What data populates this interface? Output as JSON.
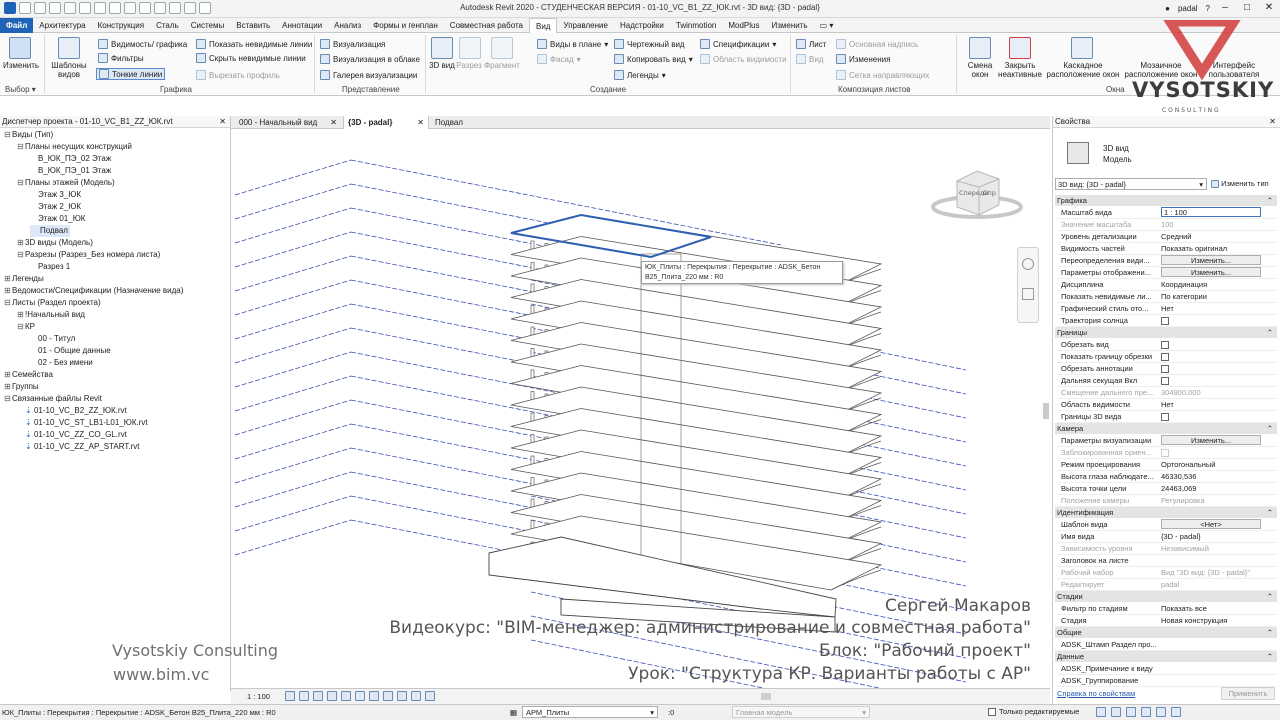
{
  "app_title": "Autodesk Revit 2020 - СТУДЕНЧЕСКАЯ ВЕРСИЯ - 01-10_VC_B1_ZZ_ЮК.rvt - 3D вид: {3D - padal}",
  "user": "padal",
  "tabs": [
    "Файл",
    "Архитектура",
    "Конструкция",
    "Сталь",
    "Системы",
    "Вставить",
    "Аннотации",
    "Анализ",
    "Формы и генплан",
    "Совместная работа",
    "Вид",
    "Управление",
    "Надстройки",
    "Twinmotion",
    "ModPlus",
    "Изменить"
  ],
  "active_tab": "Вид",
  "ribbon": {
    "modify": "Изменить",
    "view_templates": "Шаблоны видов",
    "visibility_graphics": "Видимость/ графика",
    "filters": "Фильтры",
    "thin_lines": "Тонкие линии",
    "show_hidden_lines": "Показать невидимые линии",
    "remove_hidden_lines": "Скрыть невидимые линии",
    "cut_profile": "Вырезать профиль",
    "render": "Визуализация",
    "render_cloud": "Визуализация в облаке",
    "render_gallery": "Галерея визуализации",
    "view_3d": "3D вид",
    "section": "Разрез",
    "callout": "Фрагмент",
    "plan_views": "Виды в плане",
    "elevation": "Фасад",
    "drafting_view": "Чертежный вид",
    "duplicate_view": "Копировать вид",
    "legends": "Легенды",
    "schedules": "Спецификации",
    "scope_box": "Область видимости",
    "sheet": "Лист",
    "view": "Вид",
    "title_block": "Основная надпись",
    "revisions": "Изменения",
    "guide_grid": "Сетка направляющих",
    "matchline": "Линия",
    "switch_windows": "Смена окон",
    "close_inactive": "Закрыть неактивные",
    "cascade": "Каскадное расположение окон",
    "tile": "Мозаичное расположение окон",
    "user_interface": "Интерфейс пользователя",
    "panels": {
      "select": "Выбор",
      "graphics": "Графика",
      "presentation": "Представление",
      "create": "Создание",
      "sheet_composition": "Композиция листов",
      "windows": "Окна"
    }
  },
  "project_browser": {
    "title": "Диспетчер проекта - 01-10_VC_B1_ZZ_ЮК.rvt",
    "items": [
      {
        "label": "Виды (Тип)",
        "level": 0,
        "toggle": "−"
      },
      {
        "label": "Планы несущих конструкций",
        "level": 1,
        "toggle": "−"
      },
      {
        "label": "В_ЮК_ПЭ_02 Этаж",
        "level": 2,
        "toggle": ""
      },
      {
        "label": "В_ЮК_ПЭ_01 Этаж",
        "level": 2,
        "toggle": ""
      },
      {
        "label": "Планы этажей (Модель)",
        "level": 1,
        "toggle": "−"
      },
      {
        "label": "Этаж 3_ЮК",
        "level": 2,
        "toggle": ""
      },
      {
        "label": "Этаж 2_ЮК",
        "level": 2,
        "toggle": ""
      },
      {
        "label": "Этаж 01_ЮК",
        "level": 2,
        "toggle": ""
      },
      {
        "label": "Подвал",
        "level": 2,
        "toggle": "",
        "selected": true
      },
      {
        "label": "3D виды (Модель)",
        "level": 1,
        "toggle": "+"
      },
      {
        "label": "Разрезы (Разрез_Без номера листа)",
        "level": 1,
        "toggle": "−"
      },
      {
        "label": "Разрез 1",
        "level": 2,
        "toggle": ""
      },
      {
        "label": "Легенды",
        "level": 0,
        "toggle": "+"
      },
      {
        "label": "Ведомости/Спецификации (Назначение вида)",
        "level": 0,
        "toggle": "+"
      },
      {
        "label": "Листы (Раздел проекта)",
        "level": 0,
        "toggle": "−"
      },
      {
        "label": "!Начальный вид",
        "level": 1,
        "toggle": "+"
      },
      {
        "label": "КР",
        "level": 1,
        "toggle": "−"
      },
      {
        "label": "00 - Титул",
        "level": 2,
        "toggle": ""
      },
      {
        "label": "01 - Общие данные",
        "level": 2,
        "toggle": ""
      },
      {
        "label": "02 - Без имени",
        "level": 2,
        "toggle": ""
      },
      {
        "label": "Семейства",
        "level": 0,
        "toggle": "+"
      },
      {
        "label": "Группы",
        "level": 0,
        "toggle": "+"
      },
      {
        "label": "Связанные файлы Revit",
        "level": 0,
        "toggle": "−"
      },
      {
        "label": "01-10_VC_B2_ZZ_ЮК.rvt",
        "level": 1,
        "toggle": "",
        "link": true
      },
      {
        "label": "01-10_VC_ST_LB1-L01_ЮК.rvt",
        "level": 1,
        "toggle": "",
        "link": true
      },
      {
        "label": "01-10_VC_ZZ_CO_GL.rvt",
        "level": 1,
        "toggle": "",
        "link": true
      },
      {
        "label": "01-10_VC_ZZ_AP_START.rvt",
        "level": 1,
        "toggle": "",
        "link": true
      }
    ]
  },
  "view_tabs": [
    {
      "label": "000 - Начальный вид",
      "active": false
    },
    {
      "label": "{3D - padal}",
      "active": true
    },
    {
      "label": "Подвал",
      "active": false
    }
  ],
  "tooltip": {
    "line1": "ЮК_Плиты : Перекрытия : Перекрытие : ADSK_Бетон",
    "line2": "В25_Плита_220 мм : R0"
  },
  "viewcube": {
    "front": "Спереди",
    "right": "Спр"
  },
  "watermark": {
    "author": "Сергей Макаров",
    "course": "Видеокурс: \"BIM-менеджер: администрирование и совместная работа\"",
    "block": "Блок: \"Рабочий проект\"",
    "lesson": "Урок: \"Структура КР. Варианты работы с АР\"",
    "company": "Vysotskiy Consulting",
    "site": "www.bim.vc",
    "logo_text": "VYSOTSKIY",
    "logo_sub": "C O N S U L T I N G"
  },
  "properties": {
    "title": "Свойства",
    "type_name": "3D вид",
    "type_sub": "Модель",
    "selector": "3D вид: {3D - padal}",
    "edit_type": "Изменить тип",
    "sections": [
      {
        "name": "Графика",
        "rows": [
          {
            "k": "Масштаб вида",
            "v": "1 : 100",
            "kind": "input"
          },
          {
            "k": "Значение масштаба",
            "v": "100",
            "kind": "dis"
          },
          {
            "k": "Уровень детализации",
            "v": "Средний",
            "kind": "text"
          },
          {
            "k": "Видимость частей",
            "v": "Показать оригинал",
            "kind": "text"
          },
          {
            "k": "Переопределения види...",
            "v": "Изменить...",
            "kind": "button"
          },
          {
            "k": "Параметры отображени...",
            "v": "Изменить...",
            "kind": "button"
          },
          {
            "k": "Дисциплина",
            "v": "Координация",
            "kind": "text"
          },
          {
            "k": "Показать невидимые ли...",
            "v": "По категории",
            "kind": "text"
          },
          {
            "k": "Графический стиль ото...",
            "v": "Нет",
            "kind": "text"
          },
          {
            "k": "Траектория солнца",
            "v": "",
            "kind": "check"
          }
        ]
      },
      {
        "name": "Границы",
        "rows": [
          {
            "k": "Обрезать вид",
            "v": "",
            "kind": "check"
          },
          {
            "k": "Показать границу обрезки",
            "v": "",
            "kind": "check"
          },
          {
            "k": "Обрезать аннотации",
            "v": "",
            "kind": "check"
          },
          {
            "k": "Дальняя секущая Вкл",
            "v": "",
            "kind": "check"
          },
          {
            "k": "Смещение дальнего пре...",
            "v": "304800,000",
            "kind": "dis"
          },
          {
            "k": "Область видимости",
            "v": "Нет",
            "kind": "text"
          },
          {
            "k": "Границы 3D вида",
            "v": "",
            "kind": "check"
          }
        ]
      },
      {
        "name": "Камера",
        "rows": [
          {
            "k": "Параметры визуализации",
            "v": "Изменить...",
            "kind": "button"
          },
          {
            "k": "Заблокированная ориен...",
            "v": "",
            "kind": "dischk"
          },
          {
            "k": "Режим проецирования",
            "v": "Ортогональный",
            "kind": "text"
          },
          {
            "k": "Высота глаза наблюдате...",
            "v": "46330,536",
            "kind": "text"
          },
          {
            "k": "Высота точки цели",
            "v": "24463,069",
            "kind": "text"
          },
          {
            "k": "Положение камеры",
            "v": "Регулировка",
            "kind": "dis"
          }
        ]
      },
      {
        "name": "Идентификация",
        "rows": [
          {
            "k": "Шаблон вида",
            "v": "<Нет>",
            "kind": "button"
          },
          {
            "k": "Имя вида",
            "v": "{3D - padal}",
            "kind": "text"
          },
          {
            "k": "Зависимость уровня",
            "v": "Независимый",
            "kind": "dis"
          },
          {
            "k": "Заголовок на листе",
            "v": "",
            "kind": "text"
          },
          {
            "k": "Рабочий набор",
            "v": "Вид \"3D вид: {3D - padal}\"",
            "kind": "dis"
          },
          {
            "k": "Редактирует",
            "v": "padal",
            "kind": "dis"
          }
        ]
      },
      {
        "name": "Стадии",
        "rows": [
          {
            "k": "Фильтр по стадиям",
            "v": "Показать все",
            "kind": "text"
          },
          {
            "k": "Стадия",
            "v": "Новая конструкция",
            "kind": "text"
          }
        ]
      },
      {
        "name": "Общие",
        "rows": [
          {
            "k": "ADSK_Штамп Раздел про...",
            "v": "",
            "kind": "text"
          }
        ]
      },
      {
        "name": "Данные",
        "rows": [
          {
            "k": "ADSK_Примечание к виду",
            "v": "",
            "kind": "text"
          },
          {
            "k": "ADSK_Группирование",
            "v": "",
            "kind": "text"
          }
        ]
      }
    ],
    "help_link": "Справка по свойствам",
    "apply": "Применить"
  },
  "view_control": {
    "scale": "1 : 100"
  },
  "status": {
    "text": "ЮК_Плиты : Перекрытия : Перекрытие : ADSK_Бетон В25_Плита_220 мм : R0",
    "workset": "АРМ_Плиты",
    "main_model": "Главная модель",
    "editable_only": "Только редактируемые",
    "count": ":0"
  },
  "colors": {
    "file_tab": "#1e63b5",
    "selection": "#2e5fb0",
    "logo_red": "#d03a3a"
  }
}
